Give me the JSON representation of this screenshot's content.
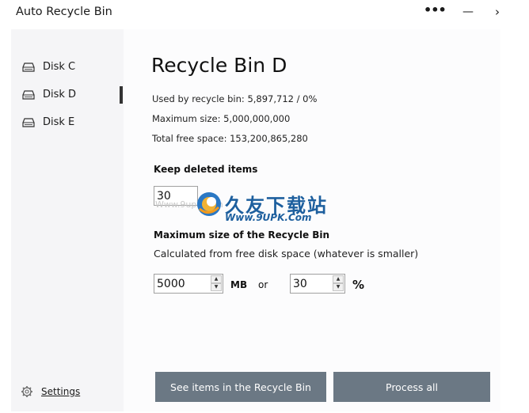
{
  "window": {
    "title": "Auto Recycle Bin",
    "more_glyph": "•••",
    "minimize_glyph": "—",
    "close_glyph": "›"
  },
  "sidebar": {
    "items": [
      {
        "label": "Disk C",
        "icon": "drive-icon",
        "selected": false
      },
      {
        "label": "Disk D",
        "icon": "drive-icon",
        "selected": true
      },
      {
        "label": "Disk E",
        "icon": "drive-icon",
        "selected": false
      }
    ],
    "settings_label": "Settings",
    "settings_icon": "gear-icon"
  },
  "main": {
    "title": "Recycle Bin D",
    "used_by_recycle_bin": "Used by recycle bin: 5,897,712 / 0%",
    "maximum_size": "Maximum size: 5,000,000,000",
    "total_free_space": "Total free space: 153,200,865,280",
    "keep_deleted_title": "Keep deleted items",
    "keep_days_value": "30",
    "max_size_title": "Maximum size of the Recycle Bin",
    "max_size_desc": "Calculated from free disk space (whatever is smaller)",
    "size_mb_value": "5000",
    "size_mb_unit": "MB",
    "or_label": "or",
    "size_percent_value": "30",
    "size_percent_unit": "%",
    "see_items_button": "See items in the Recycle Bin",
    "process_all_button": "Process all"
  },
  "watermark": {
    "line1": "久友下载站",
    "line2": "Www.9UPK.Com",
    "faint": "Www.9upk.com"
  },
  "colors": {
    "button_bg": "#6b7884",
    "sidebar_bg": "#f5f5f7",
    "selection_indicator": "#333333",
    "watermark_blue": "#1d5f9e"
  }
}
